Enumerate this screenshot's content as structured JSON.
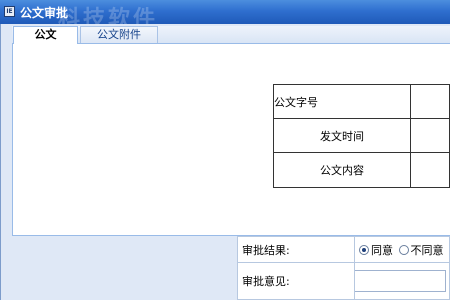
{
  "window": {
    "title": "公文审批",
    "watermark": "科技软件",
    "icon": "app-window-icon",
    "icon_text": "IE"
  },
  "tabs": [
    {
      "label": "公文",
      "active": true
    },
    {
      "label": "公文附件",
      "active": false
    }
  ],
  "document_fields": {
    "doc_number_label": "公文字号",
    "doc_number_value": "",
    "issue_time_label": "发文时间",
    "issue_time_value": "",
    "content_label": "公文内容",
    "content_value": ""
  },
  "approval": {
    "result_label": "审批结果:",
    "options": [
      {
        "label": "同意",
        "selected": true
      },
      {
        "label": "不同意",
        "selected": false
      }
    ],
    "opinion_label": "审批意见:",
    "opinion_value": ""
  },
  "colors": {
    "titlebar": "#2f6fcf",
    "frame": "#dfe8f6",
    "tab_border": "#99bbe8"
  }
}
